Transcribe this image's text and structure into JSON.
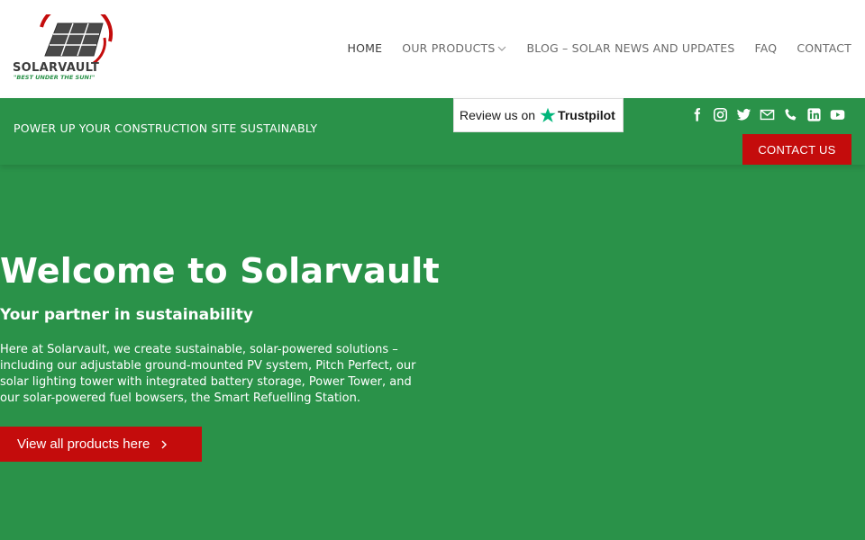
{
  "brand": {
    "name": "SOLARVAULT",
    "tagline": "\"BEST UNDER THE SUN!\""
  },
  "nav": {
    "items": [
      {
        "label": "HOME",
        "active": true
      },
      {
        "label": "OUR PRODUCTS",
        "has_dropdown": true
      },
      {
        "label": "BLOG – SOLAR NEWS AND UPDATES"
      },
      {
        "label": "FAQ"
      },
      {
        "label": "CONTACT"
      }
    ]
  },
  "topbar": {
    "announcement": "POWER UP YOUR CONSTRUCTION SITE SUSTAINABLY",
    "trustpilot_prefix": "Review us on",
    "trustpilot_brand": "Trustpilot",
    "socials": [
      "facebook-icon",
      "instagram-icon",
      "twitter-icon",
      "email-icon",
      "phone-icon",
      "linkedin-icon",
      "youtube-icon"
    ],
    "contact_label": "CONTACT US"
  },
  "hero": {
    "title": "Welcome to Solarvault",
    "subtitle": "Your partner in sustainability",
    "body": "Here at Solarvault, we create sustainable, solar-powered solutions – including our adjustable ground-mounted PV system, Pitch Perfect, our solar lighting tower with integrated battery storage, Power Tower, and our solar-powered fuel bowsers, the Smart Refuelling Station.",
    "cta_label": "View all products here"
  },
  "colors": {
    "green": "#2a9249",
    "red": "#c40c0c",
    "trustpilot_green": "#00b67a"
  }
}
